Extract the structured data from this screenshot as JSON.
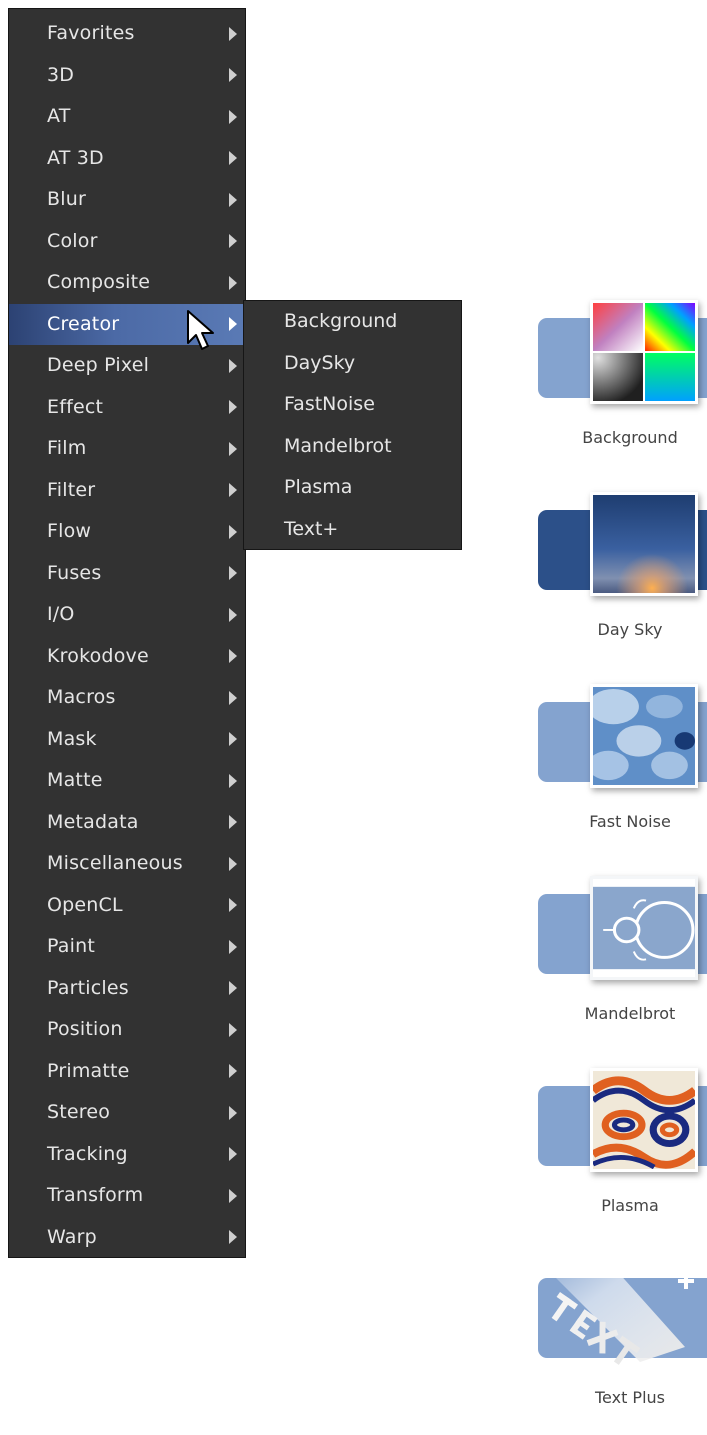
{
  "menu": {
    "items": [
      {
        "label": "Favorites"
      },
      {
        "label": "3D"
      },
      {
        "label": "AT"
      },
      {
        "label": "AT 3D"
      },
      {
        "label": "Blur"
      },
      {
        "label": "Color"
      },
      {
        "label": "Composite"
      },
      {
        "label": "Creator",
        "selected": true
      },
      {
        "label": "Deep Pixel"
      },
      {
        "label": "Effect"
      },
      {
        "label": "Film"
      },
      {
        "label": "Filter"
      },
      {
        "label": "Flow"
      },
      {
        "label": "Fuses"
      },
      {
        "label": "I/O"
      },
      {
        "label": "Krokodove"
      },
      {
        "label": "Macros"
      },
      {
        "label": "Mask"
      },
      {
        "label": "Matte"
      },
      {
        "label": "Metadata"
      },
      {
        "label": "Miscellaneous"
      },
      {
        "label": "OpenCL"
      },
      {
        "label": "Paint"
      },
      {
        "label": "Particles"
      },
      {
        "label": "Position"
      },
      {
        "label": "Primatte"
      },
      {
        "label": "Stereo"
      },
      {
        "label": "Tracking"
      },
      {
        "label": "Transform"
      },
      {
        "label": "Warp"
      }
    ],
    "submenu_icon": "chevron-right-icon",
    "selection_color": "#4c6aa6"
  },
  "submenu": {
    "parent": "Creator",
    "items": [
      {
        "label": "Background"
      },
      {
        "label": "DaySky"
      },
      {
        "label": "FastNoise"
      },
      {
        "label": "Mandelbrot"
      },
      {
        "label": "Plasma"
      },
      {
        "label": "Text+"
      }
    ]
  },
  "tools": [
    {
      "label": "Background",
      "icon": "background-tool-icon",
      "accent": "#84a3cf"
    },
    {
      "label": "Day Sky",
      "icon": "daysky-tool-icon",
      "accent": "#2c5089"
    },
    {
      "label": "Fast Noise",
      "icon": "fastnoise-tool-icon",
      "accent": "#84a3cf"
    },
    {
      "label": "Mandelbrot",
      "icon": "mandelbrot-tool-icon",
      "accent": "#84a3cf"
    },
    {
      "label": "Plasma",
      "icon": "plasma-tool-icon",
      "accent": "#84a3cf"
    },
    {
      "label": "Text Plus",
      "icon": "textplus-tool-icon",
      "accent": "#84a3cf"
    }
  ],
  "cursor_icon": "mouse-pointer-icon"
}
